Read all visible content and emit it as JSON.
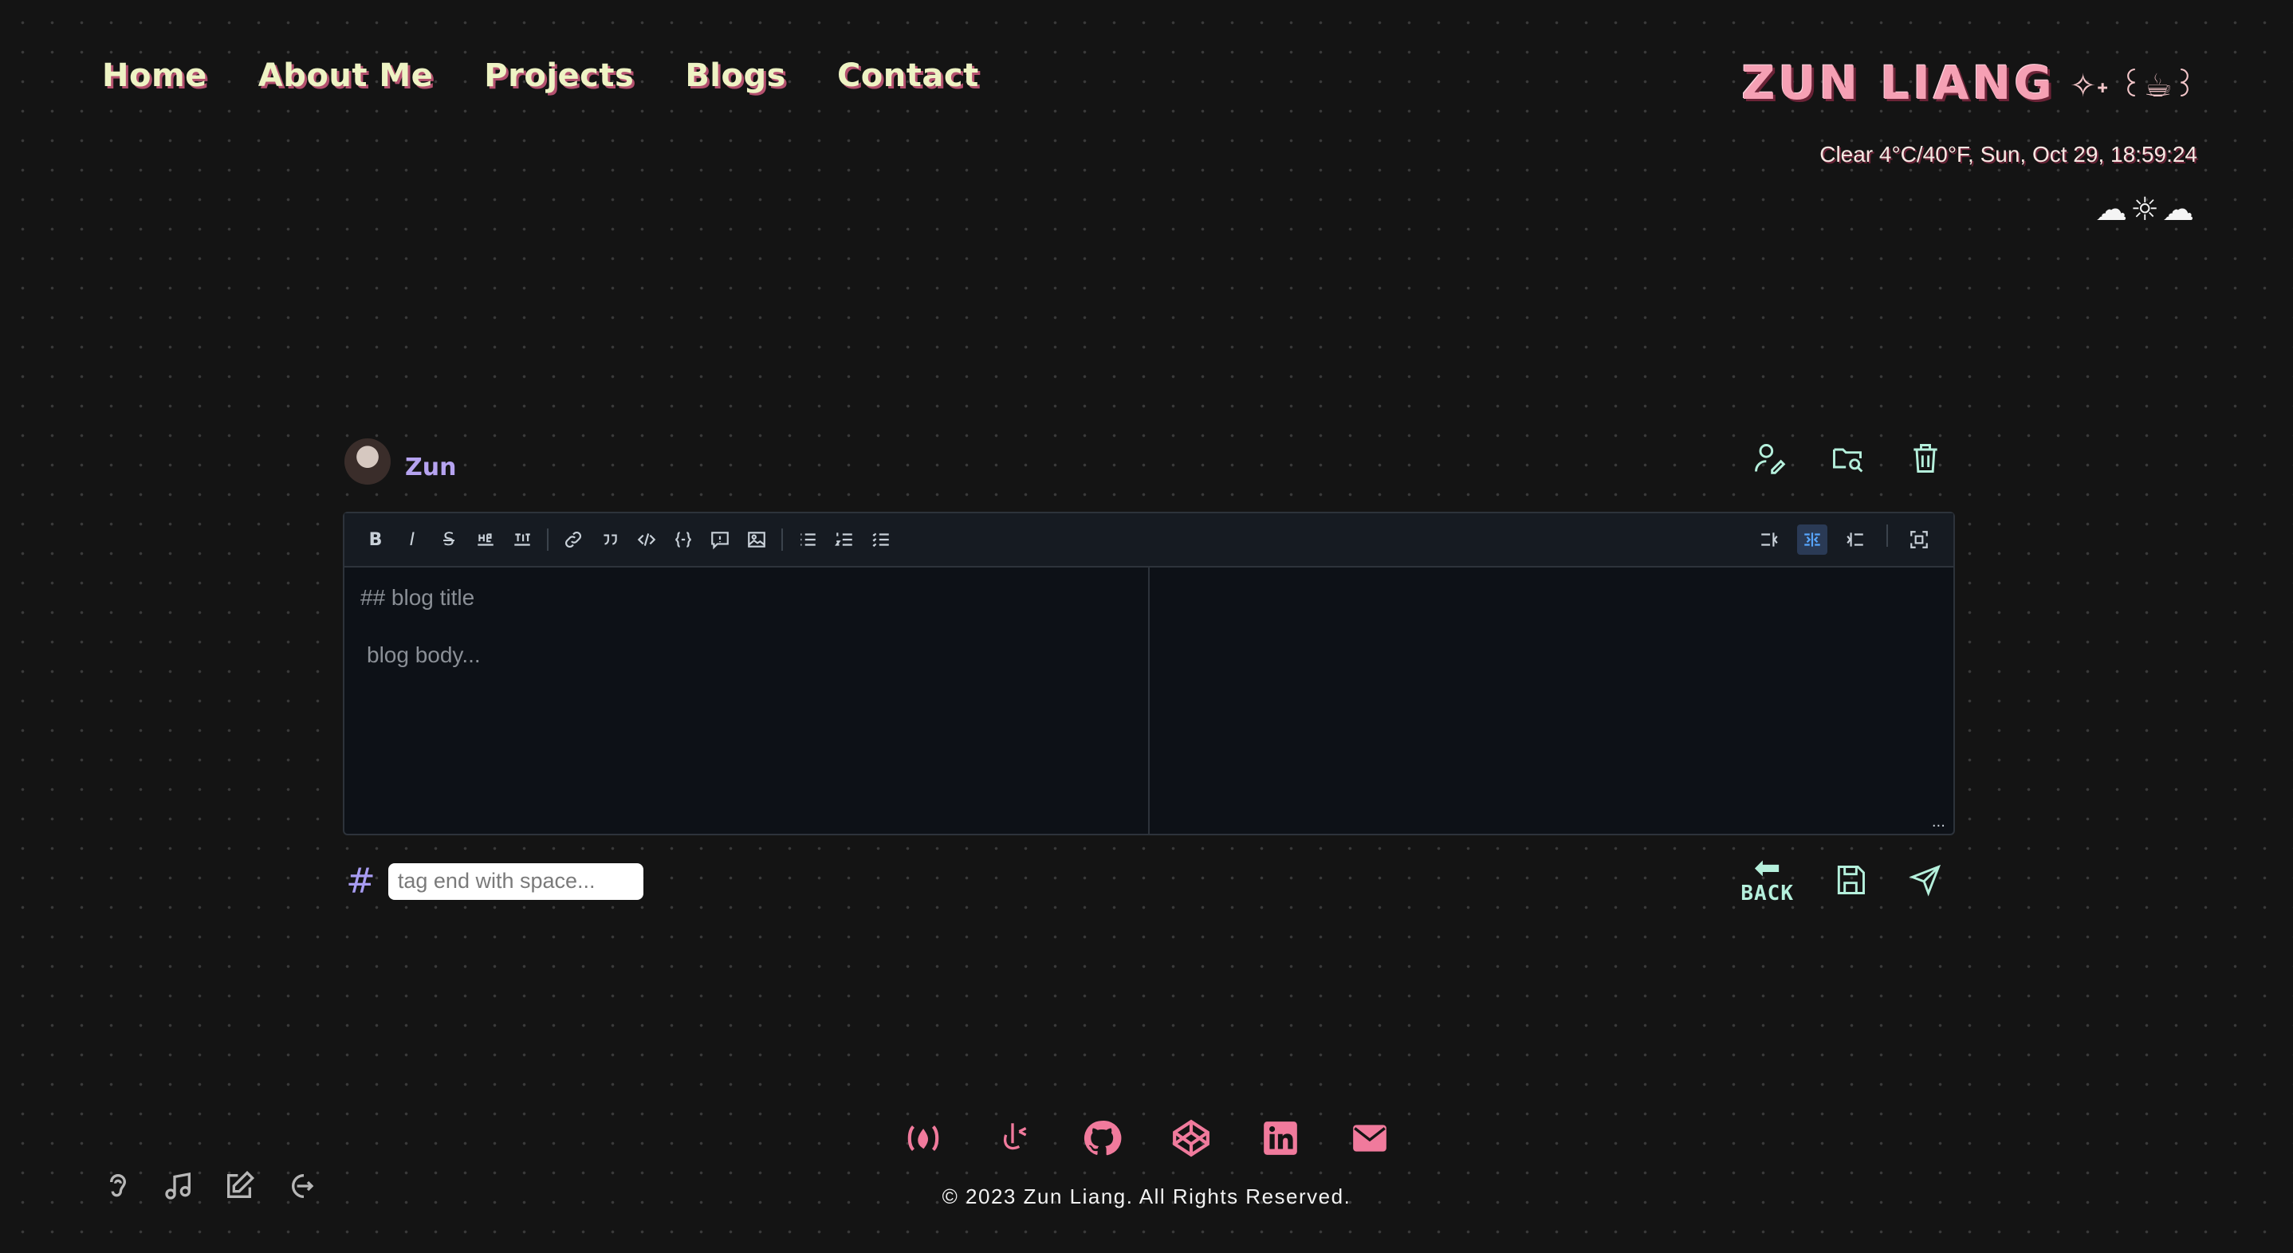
{
  "nav": {
    "items": [
      "Home",
      "About Me",
      "Projects",
      "Blogs",
      "Contact"
    ]
  },
  "brand": {
    "title": "ZUN LIANG",
    "decor": "✧˖ ꒰☕꒱"
  },
  "weather": {
    "text": "Clear 4°C/40°F,  Sun, Oct 29, 18:59:24",
    "clouds": "☁☼☁"
  },
  "user": {
    "name": "Zun"
  },
  "editor": {
    "title_placeholder": "## blog title",
    "body_placeholder": "blog body...",
    "resize": "..."
  },
  "tags": {
    "hash": "#",
    "placeholder": "tag end with space..."
  },
  "actions": {
    "back_label": "BACK"
  },
  "footer": {
    "copyright": "© 2023 Zun Liang. All Rights Reserved."
  },
  "colors": {
    "accent_pink": "#f07a9c",
    "mint": "#b5f0dc",
    "nav_text": "#eef3c4",
    "username": "#b6a3f0"
  }
}
